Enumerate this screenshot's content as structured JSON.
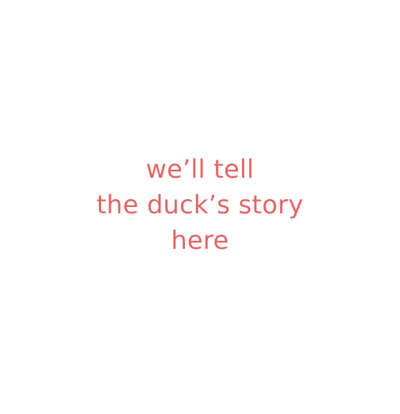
{
  "message": {
    "lines": [
      "we’ll tell",
      "the duck’s story",
      "here"
    ]
  },
  "colors": {
    "background": "#ffffff",
    "text": "#e06666"
  }
}
